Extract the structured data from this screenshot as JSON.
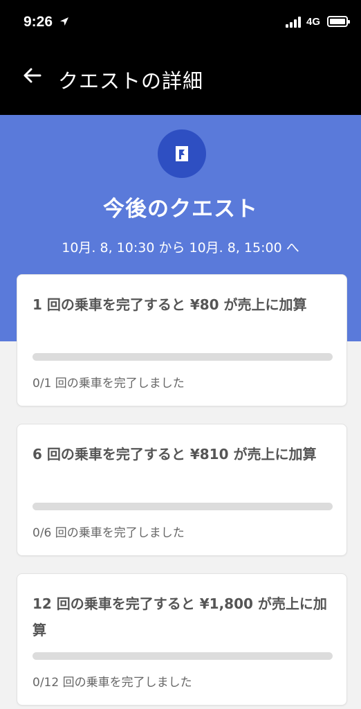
{
  "status_bar": {
    "time": "9:26",
    "network": "4G"
  },
  "header": {
    "title": "クエストの詳細"
  },
  "hero": {
    "title": "今後のクエスト",
    "date_range": "10月. 8, 10:30 から 10月. 8, 15:00 へ",
    "icon": "quest-flag-icon"
  },
  "colors": {
    "hero_bg": "#5a7ada",
    "icon_bg": "#2e4fc2",
    "header_bg": "#000000"
  },
  "quests": [
    {
      "title": "1 回の乗車を完了すると ¥80 が売上に加算",
      "progress_text": "0/1 回の乗車を完了しました",
      "progress": 0
    },
    {
      "title": "6 回の乗車を完了すると ¥810 が売上に加算",
      "progress_text": "0/6 回の乗車を完了しました",
      "progress": 0
    },
    {
      "title": "12 回の乗車を完了すると ¥1,800 が売上に加算",
      "progress_text": "0/12 回の乗車を完了しました",
      "progress": 0
    }
  ]
}
